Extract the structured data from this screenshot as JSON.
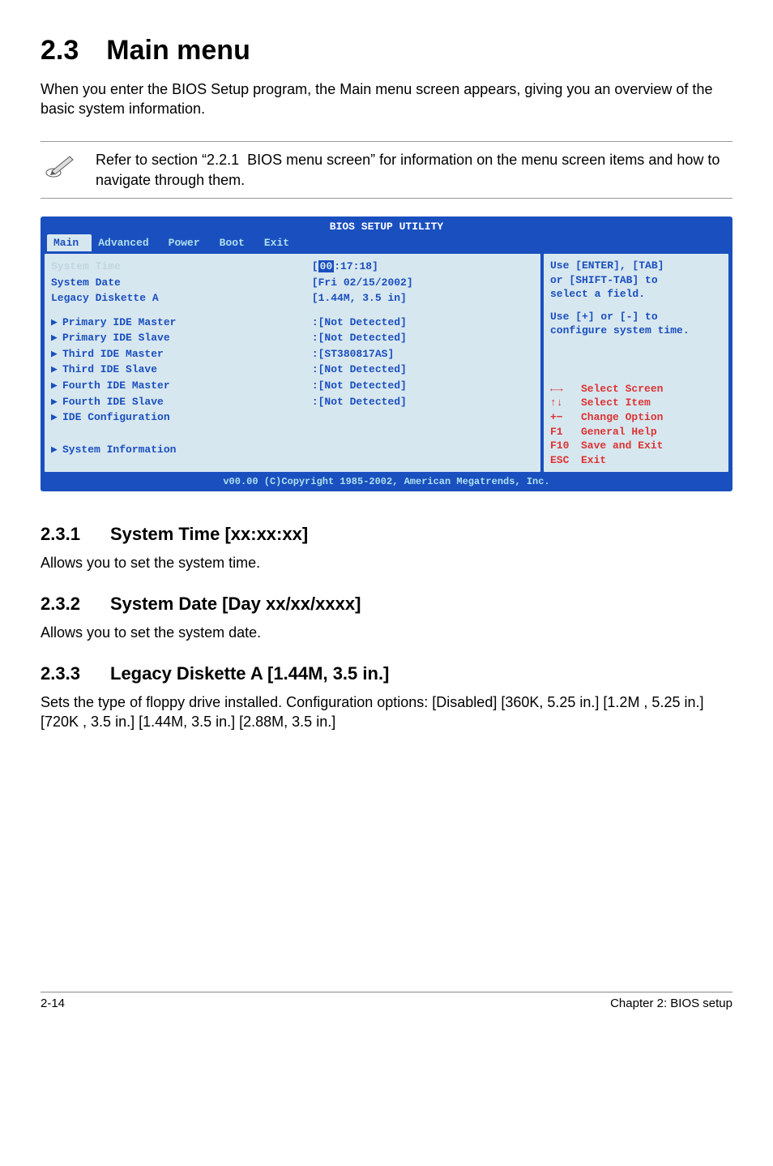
{
  "title": "2.3 Main menu",
  "intro": "When you enter the BIOS Setup program, the Main menu screen appears, giving you an overview of the basic system information.",
  "note": "Refer to section “2.2.1  BIOS menu screen” for information on the menu screen items and how to navigate through them.",
  "bios": {
    "header": "BIOS SETUP UTILITY",
    "tabs": [
      "Main",
      "Advanced",
      "Power",
      "Boot",
      "Exit"
    ],
    "active_tab": 0,
    "left": {
      "rows": [
        {
          "label": "System Time",
          "value": "[00:17:18]",
          "highlight_hh": true,
          "sys_time": true
        },
        {
          "label": "System Date",
          "value": "[Fri 02/15/2002]"
        },
        {
          "label": "Legacy Diskette A",
          "value": "[1.44M, 3.5 in]"
        }
      ],
      "items": [
        {
          "label": "Primary IDE Master",
          "value": ":[Not Detected]"
        },
        {
          "label": "Primary IDE Slave",
          "value": ":[Not Detected]"
        },
        {
          "label": "Third IDE Master",
          "value": ":[ST380817AS]"
        },
        {
          "label": "Third IDE Slave",
          "value": ":[Not Detected]"
        },
        {
          "label": "Fourth IDE Master",
          "value": ":[Not Detected]"
        },
        {
          "label": "Fourth IDE Slave",
          "value": ":[Not Detected]"
        },
        {
          "label": "IDE Configuration",
          "value": ""
        }
      ],
      "last": {
        "label": "System Information"
      }
    },
    "right": {
      "help": [
        "Use [ENTER], [TAB]",
        "or [SHIFT-TAB] to",
        "select a field.",
        "",
        "Use [+] or [-] to",
        "configure system time."
      ],
      "keys": [
        {
          "k": "←→",
          "v": "Select Screen"
        },
        {
          "k": "↑↓",
          "v": "Select Item"
        },
        {
          "k": "+−",
          "v": "Change Option"
        },
        {
          "k": "F1",
          "v": "General Help"
        },
        {
          "k": "F10",
          "v": "Save and Exit"
        },
        {
          "k": "ESC",
          "v": "Exit"
        }
      ]
    },
    "footer": "v00.00 (C)Copyright 1985-2002, American Megatrends, Inc."
  },
  "sections": [
    {
      "num": "2.3.1",
      "title": "System Time [xx:xx:xx]",
      "body": "Allows you to set the system time."
    },
    {
      "num": "2.3.2",
      "title": "System Date [Day xx/xx/xxxx]",
      "body": "Allows you to set the system date."
    },
    {
      "num": "2.3.3",
      "title": "Legacy Diskette A [1.44M, 3.5 in.]",
      "body": "Sets the type of floppy drive installed. Configuration options: [Disabled] [360K, 5.25 in.] [1.2M , 5.25 in.] [720K , 3.5 in.] [1.44M, 3.5 in.] [2.88M, 3.5 in.]"
    }
  ],
  "footer": {
    "left": "2-14",
    "right": "Chapter 2: BIOS setup"
  }
}
